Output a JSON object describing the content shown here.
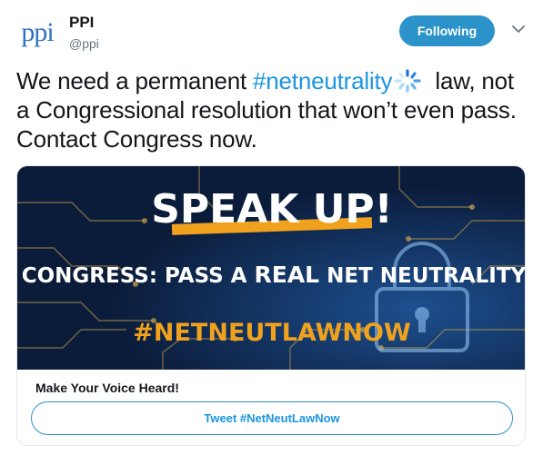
{
  "account": {
    "avatar_text": "ppi",
    "display_name": "PPI",
    "handle": "@ppi",
    "follow_button": "Following"
  },
  "tweet": {
    "text_before": "We need a permanent ",
    "hashtag": "#netneutrality",
    "text_after": " law, not a Congressional resolution that won’t even pass. Contact Congress now."
  },
  "card": {
    "image": {
      "headline": "SPEAK UP!",
      "subhead_part1": "TELL CONGRESS: PASS A ",
      "subhead_bold": "REAL",
      "subhead_part2": " NET NEUTRALITY LAW",
      "hashtag": "#NETNEUTLAWNOW"
    },
    "title": "Make Your Voice Heard!",
    "button_label": "Tweet #NetNeutLawNow"
  },
  "colors": {
    "brand_blue": "#2b93c9",
    "link_blue": "#1b95e0",
    "image_background": "#0e2347",
    "accent_orange": "#f0a21e"
  },
  "icons": {
    "menu": "chevron-down-icon",
    "emoji": "spinner-emoji-icon",
    "lock": "padlock-icon"
  }
}
